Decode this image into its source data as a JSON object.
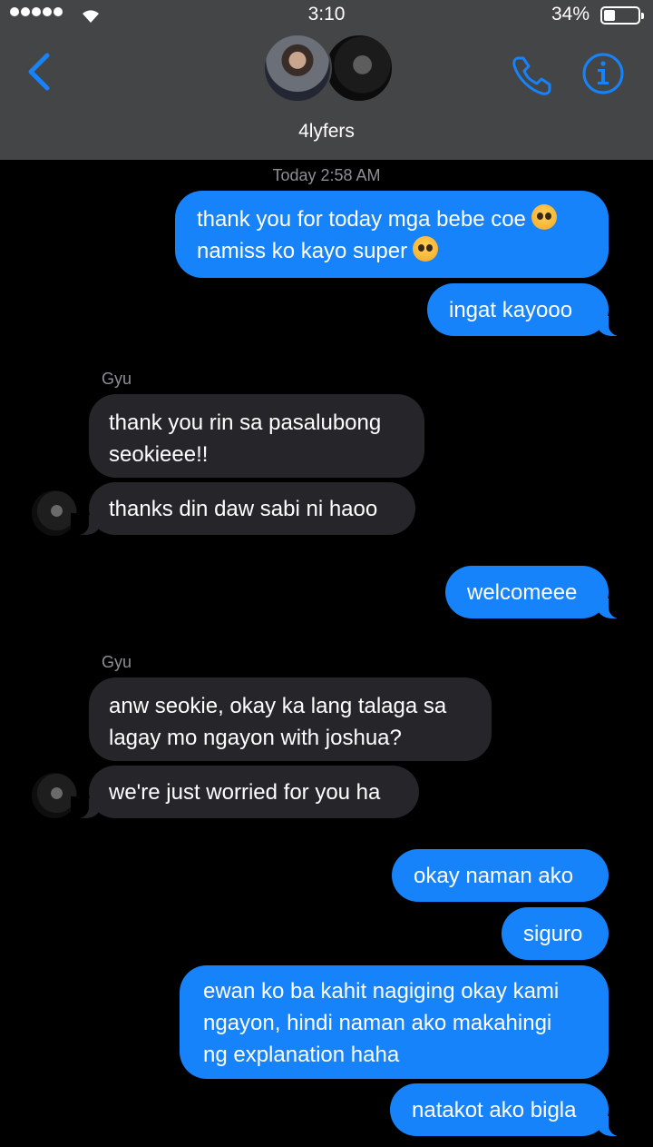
{
  "status_bar": {
    "time": "3:10",
    "battery_percent": "34%",
    "battery_level": 0.34
  },
  "header": {
    "group_name": "4lyfers",
    "back_icon": "chevron-left-icon",
    "call_icon": "phone-icon",
    "info_icon": "info-icon",
    "accent_color": "#1683fb"
  },
  "conversation": {
    "timestamp": "Today 2:58 AM",
    "messages": [
      {
        "from": "me",
        "lines": [
          "thank you for today mga bebe coe",
          "namiss ko kayo super"
        ],
        "emoji": "pleading-face-emoji"
      },
      {
        "from": "me",
        "text": "ingat kayooo"
      },
      {
        "from": "Gyu",
        "lines": [
          "thank you rin sa pasalubong",
          "seokieee!!"
        ]
      },
      {
        "from": "Gyu",
        "text": "thanks din daw sabi ni haoo"
      },
      {
        "from": "me",
        "text": "welcomeee"
      },
      {
        "from": "Gyu",
        "lines": [
          "anw seokie, okay ka lang talaga sa",
          "lagay mo ngayon with joshua?"
        ]
      },
      {
        "from": "Gyu",
        "text": "we're just worried for you ha"
      },
      {
        "from": "me",
        "text": "okay naman ako"
      },
      {
        "from": "me",
        "text": "siguro"
      },
      {
        "from": "me",
        "lines": [
          "ewan ko ba kahit nagiging okay kami",
          "ngayon, hindi naman ako makahingi",
          "ng explanation haha"
        ]
      },
      {
        "from": "me",
        "text": "natakot ako bigla"
      }
    ],
    "sender_label_1": "Gyu",
    "sender_label_2": "Gyu"
  },
  "colors": {
    "sent_bubble": "#1683fb",
    "received_bubble": "#26252a",
    "header_bg": "#444546",
    "timestamp_text": "#8e8e93"
  }
}
